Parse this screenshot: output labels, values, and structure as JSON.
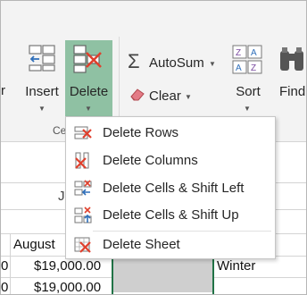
{
  "ribbon": {
    "insert_label": "Insert",
    "delete_label": "Delete",
    "autosum_label": "AutoSum",
    "clear_label": "Clear",
    "sort_label": "Sort",
    "find_label": "Find",
    "group_label_partial": "Ce",
    "left_partial": "r",
    "accent_color": "#8fc1a3"
  },
  "menu": {
    "items": [
      {
        "label": "Delete Rows",
        "icon": "delete-rows-icon"
      },
      {
        "label": "Delete Columns",
        "icon": "delete-columns-icon"
      },
      {
        "label": "Delete Cells & Shift Left",
        "icon": "shift-left-icon"
      },
      {
        "label": "Delete Cells & Shift Up",
        "icon": "shift-up-icon"
      },
      {
        "label": "Delete Sheet",
        "icon": "delete-sheet-icon"
      }
    ]
  },
  "sheet": {
    "partial_j": "J",
    "header_august": "August",
    "row1_left": "0",
    "row1_august": "$19,000.00",
    "row1_season": "Winter",
    "row2_left": "0",
    "row2_august": "$19,000.00"
  }
}
